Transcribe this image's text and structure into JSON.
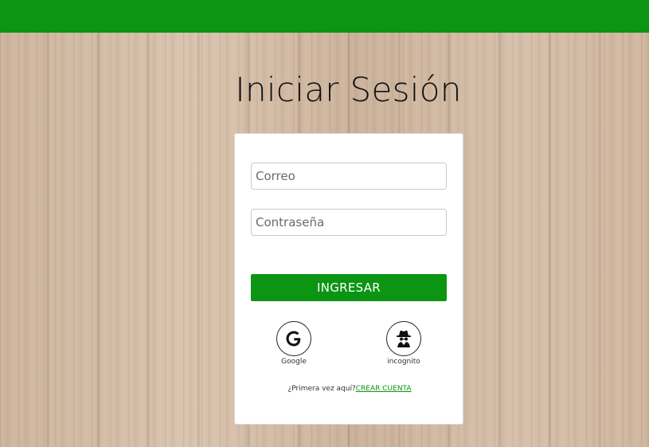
{
  "colors": {
    "brand_green": "#0c9413",
    "card_bg": "#ffffff"
  },
  "login": {
    "title": "Iniciar Sesión",
    "email": {
      "placeholder": "Correo",
      "value": ""
    },
    "password": {
      "placeholder": "Contraseña",
      "value": ""
    },
    "submit_label": "INGRESAR",
    "social": [
      {
        "label": "Google",
        "icon": "google-g-icon"
      },
      {
        "label": "incognito",
        "icon": "incognito-spy-icon"
      }
    ],
    "signup_prompt": "¿Primera vez aquí?",
    "signup_link": "CREAR CUENTA"
  }
}
